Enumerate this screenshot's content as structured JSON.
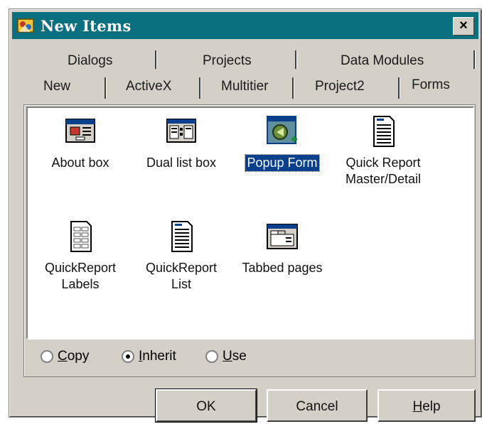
{
  "window": {
    "title": "New Items",
    "close_label": "×"
  },
  "tabs": {
    "row_back": [
      "Dialogs",
      "Projects",
      "Data Modules"
    ],
    "row_front": [
      "New",
      "ActiveX",
      "Multitier",
      "Project2",
      "Forms"
    ],
    "active": "Forms"
  },
  "items": [
    {
      "label": "About box",
      "icon": "about-box-icon",
      "selected": false
    },
    {
      "label": "Dual list box",
      "icon": "dual-list-box-icon",
      "selected": false
    },
    {
      "label": "Popup Form",
      "icon": "popup-form-icon",
      "selected": true
    },
    {
      "label_lines": [
        "Quick Report",
        "Master/Detail"
      ],
      "icon": "quick-report-master-detail-icon",
      "selected": false
    },
    {
      "label_lines": [
        "QuickReport",
        "Labels"
      ],
      "icon": "quickreport-labels-icon",
      "selected": false
    },
    {
      "label_lines": [
        "QuickReport",
        "List"
      ],
      "icon": "quickreport-list-icon",
      "selected": false
    },
    {
      "label": "Tabbed pages",
      "icon": "tabbed-pages-icon",
      "selected": false
    }
  ],
  "options": {
    "copy": {
      "label_rest": "opy",
      "accel": "C",
      "checked": false
    },
    "inherit": {
      "label_rest": "nherit",
      "accel": "I",
      "checked": true
    },
    "use": {
      "label_rest": "se",
      "accel": "U",
      "checked": false
    }
  },
  "buttons": {
    "ok": "OK",
    "cancel": "Cancel",
    "help_accel": "H",
    "help_rest": "elp"
  },
  "colors": {
    "titlebar": "#0a6f7f",
    "face": "#d4d0c8",
    "selection": "#0a3f8c"
  }
}
